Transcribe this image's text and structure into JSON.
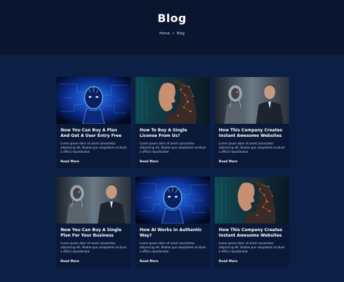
{
  "page": {
    "title": "Blog"
  },
  "breadcrumb": {
    "home": "Home",
    "current": "Blog"
  },
  "posts": [
    {
      "title": "Now You Can Buy A Plan And Get A User Entry Free",
      "excerpt": "Lorem ipsum dolor sit amet consectetur adipisicing elit. Beatae quo voluptatem incidunt a officia repudiandae",
      "more": "Read More",
      "image": "blue-robot"
    },
    {
      "title": "How To Buy A Single License From Us?",
      "excerpt": "Lorem ipsum dolor sit amet consectetur adipisicing elit. Beatae quo voluptatem incidunt a officia repudiandae",
      "more": "Read More",
      "image": "circuit-face"
    },
    {
      "title": "How This Company Creates Instant Awesome Websites",
      "excerpt": "Lorem ipsum dolor sit amet consectetur adipisicing elit. Beatae quo voluptatem incidunt a officia repudiandae",
      "more": "Read More",
      "image": "robot-and-man"
    },
    {
      "title": "Now You Can Buy A Single Plan For Your Business",
      "excerpt": "Lorem ipsum dolor sit amet consectetur adipisicing elit. Beatae quo voluptatem incidunt a officia repudiandae",
      "more": "Read More",
      "image": "robot-and-man"
    },
    {
      "title": "How AI Works In Authentic Way?",
      "excerpt": "Lorem ipsum dolor sit amet consectetur adipisicing elit. Beatae quo voluptatem incidunt a officia repudiandae",
      "more": "Read More",
      "image": "blue-robot"
    },
    {
      "title": "How This Company Creates Instant Awesome Websites",
      "excerpt": "Lorem ipsum dolor sit amet consectetur adipisicing elit. Beatae quo voluptatem incidunt a officia repudiandae",
      "more": "Read More",
      "image": "circuit-face"
    }
  ],
  "colors": {
    "background": "#0c1f45",
    "hero": "#0a1530",
    "card": "#0a1938"
  }
}
